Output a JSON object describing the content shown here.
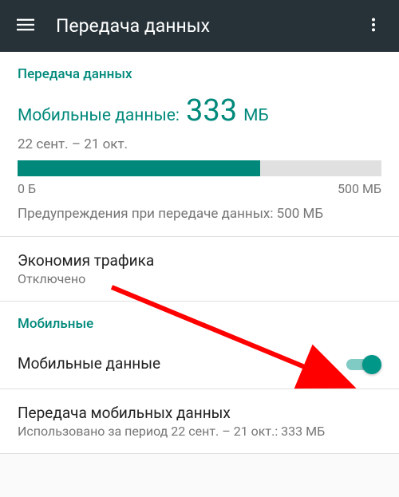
{
  "appbar": {
    "title": "Передача данных"
  },
  "usage": {
    "section_header": "Передача данных",
    "label": "Мобильные данные:",
    "value": "333",
    "unit": "МБ",
    "date_range": "22 сент. – 21 окт.",
    "min_label": "0 Б",
    "max_label": "500 МБ",
    "warning": "Предупреждения при передаче данных: 500 МБ"
  },
  "data_saver": {
    "title": "Экономия трафика",
    "status": "Отключено"
  },
  "mobile_section": {
    "header": "Мобильные"
  },
  "mobile_data": {
    "label": "Мобильные данные"
  },
  "mobile_usage": {
    "title": "Передача мобильных данных",
    "subtitle": "Использовано за период 22 сент. – 21 окт.: 333 МБ"
  }
}
